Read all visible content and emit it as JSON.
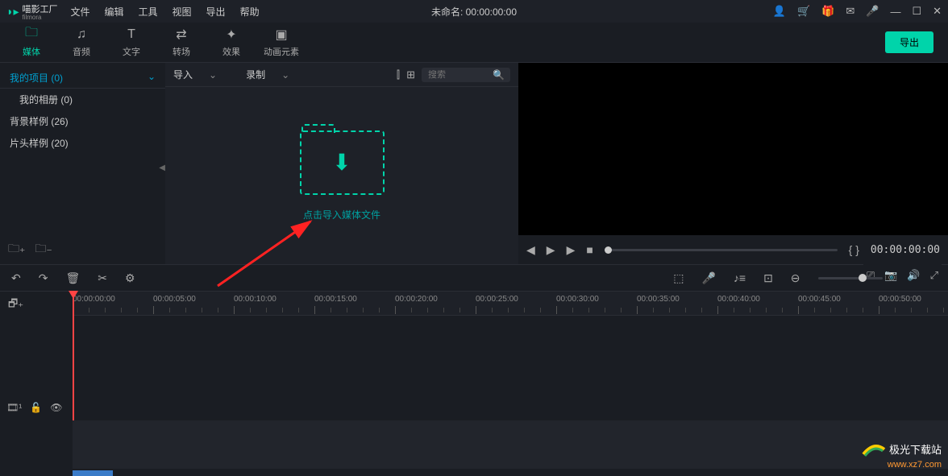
{
  "app": {
    "name": "喵影工厂",
    "sub": "filmora"
  },
  "menu": [
    "文件",
    "编辑",
    "工具",
    "视图",
    "导出",
    "帮助"
  ],
  "title": {
    "untitled": "未命名:",
    "time": "00:00:00:00"
  },
  "titlebar_icons": [
    "user",
    "cart",
    "gift",
    "mail",
    "mic",
    "min",
    "max",
    "close"
  ],
  "tabs": [
    {
      "label": "媒体",
      "icon": "folder"
    },
    {
      "label": "音频",
      "icon": "music"
    },
    {
      "label": "文字",
      "icon": "text"
    },
    {
      "label": "转场",
      "icon": "transition"
    },
    {
      "label": "效果",
      "icon": "sparkle"
    },
    {
      "label": "动画元素",
      "icon": "image"
    }
  ],
  "export_btn": "导出",
  "sidebar": {
    "header": "我的项目 (0)",
    "items": [
      {
        "label": "我的相册 (0)",
        "indent": true
      },
      {
        "label": "背景样例 (26)",
        "indent": false
      },
      {
        "label": "片头样例 (20)",
        "indent": false
      }
    ]
  },
  "media_toolbar": {
    "import": "导入",
    "record": "录制",
    "search_placeholder": "搜索"
  },
  "drop_text": "点击导入媒体文件",
  "preview": {
    "time": "00:00:00:00"
  },
  "ruler": [
    "00:00:00:00",
    "00:00:05:00",
    "00:00:10:00",
    "00:00:15:00",
    "00:00:20:00",
    "00:00:25:00",
    "00:00:30:00",
    "00:00:35:00",
    "00:00:40:00",
    "00:00:45:00",
    "00:00:50:00"
  ],
  "watermark": {
    "text": "极光下载站",
    "url": "www.xz7.com"
  }
}
